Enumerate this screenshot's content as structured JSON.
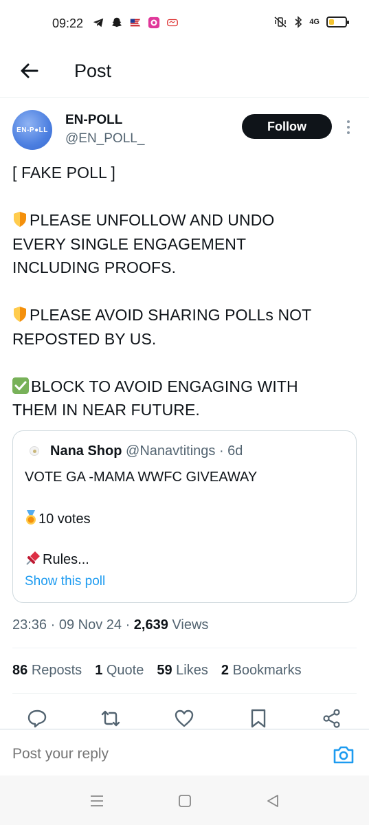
{
  "status_bar": {
    "time": "09:22",
    "network": "4G",
    "battery_level": 0.3,
    "battery_color": "#f4c430"
  },
  "header": {
    "back_icon": "arrow-left-icon",
    "title": "Post"
  },
  "author": {
    "avatar_text": "EN-P●LL",
    "name": "EN-POLL",
    "handle": "@EN_POLL_",
    "follow_label": "Follow"
  },
  "post": {
    "line1": "[ FAKE POLL ]",
    "para2_line1": "PLEASE UNFOLLOW AND UNDO",
    "para2_line2": "EVERY SINGLE ENGAGEMENT",
    "para2_line3": "INCLUDING PROOFS.",
    "para3_line1": "PLEASE AVOID SHARING POLLs NOT",
    "para3_line2": "REPOSTED BY US.",
    "para4_line1": "BLOCK TO AVOID ENGAGING WITH",
    "para4_line2": "THEM IN NEAR FUTURE."
  },
  "quote": {
    "name": "Nana Shop",
    "handle": "@Nanavtitings",
    "time": "· 6d",
    "line1": "VOTE GA -MAMA WWFC GIVEAWAY",
    "line2": "10 votes",
    "line3": "Rules...",
    "show_poll": "Show this poll"
  },
  "meta": {
    "time": "23:36",
    "date": "09 Nov 24",
    "views_count": "2,639",
    "views_label": "Views"
  },
  "stats": {
    "reposts_count": "86",
    "reposts_label": "Reposts",
    "quote_count": "1",
    "quote_label": "Quote",
    "likes_count": "59",
    "likes_label": "Likes",
    "bookmarks_count": "2",
    "bookmarks_label": "Bookmarks"
  },
  "actions": [
    "reply-icon",
    "repost-icon",
    "like-icon",
    "bookmark-icon",
    "share-icon"
  ],
  "reply": {
    "placeholder": "Post your reply"
  },
  "colors": {
    "accent": "#1d9bf0",
    "text": "#0f1419",
    "muted": "#536471"
  }
}
